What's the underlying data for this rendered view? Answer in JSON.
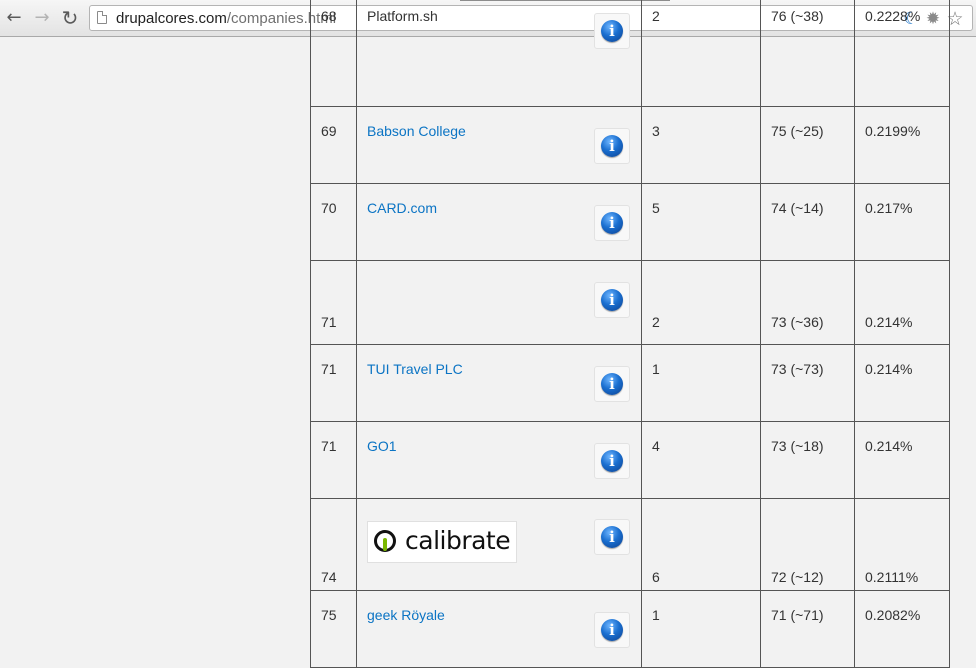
{
  "browser": {
    "back_glyph": "←",
    "forward_glyph": "→",
    "reload_glyph": "↻",
    "url_host": "drupalcores.com",
    "url_path": "/companies.html",
    "star_glyph": "☆",
    "gear_glyph": "✹",
    "ext_glyph": "☾"
  },
  "rows": [
    {
      "rank": "68",
      "name": "Platform.sh",
      "linked": false,
      "count": "2",
      "commits": "76 (~38)",
      "percent": "0.2228%"
    },
    {
      "rank": "69",
      "name": "Babson College",
      "linked": true,
      "count": "3",
      "commits": "75 (~25)",
      "percent": "0.2199%"
    },
    {
      "rank": "70",
      "name": "CARD.com",
      "linked": true,
      "count": "5",
      "commits": "74 (~14)",
      "percent": "0.217%"
    },
    {
      "rank": "71",
      "name": "",
      "linked": false,
      "count": "2",
      "commits": "73 (~36)",
      "percent": "0.214%"
    },
    {
      "rank": "71",
      "name": "TUI Travel PLC",
      "linked": true,
      "count": "1",
      "commits": "73 (~73)",
      "percent": "0.214%"
    },
    {
      "rank": "71",
      "name": "GO1",
      "linked": true,
      "count": "4",
      "commits": "73 (~18)",
      "percent": "0.214%"
    },
    {
      "rank": "74",
      "name": "",
      "logo_text": "calibrate",
      "linked": false,
      "count": "6",
      "commits": "72 (~12)",
      "percent": "0.2111%"
    },
    {
      "rank": "75",
      "name": "geek Röyale",
      "linked": true,
      "count": "1",
      "commits": "71 (~71)",
      "percent": "0.2082%"
    }
  ],
  "info_glyph": "i",
  "colors": {
    "link": "#0b74c4",
    "info_blue": "#1a6fd0"
  }
}
